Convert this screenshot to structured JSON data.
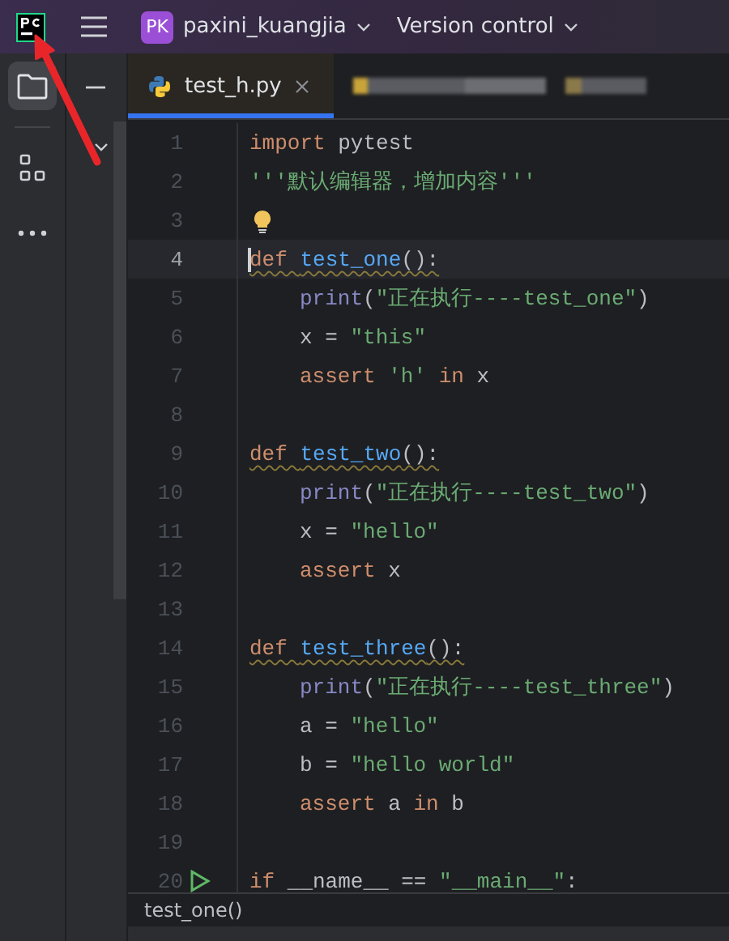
{
  "title_bar": {
    "project_initials": "PK",
    "project": "paxini_kuangjia",
    "vcs": "Version control"
  },
  "activity_bar": [
    {
      "kind": "folder",
      "selected": true
    },
    {
      "kind": "structure",
      "selected": false
    },
    {
      "kind": "more",
      "selected": false
    }
  ],
  "tabs": [
    {
      "label": "test_h.py",
      "selected": true
    }
  ],
  "lines": [
    {
      "number": "1",
      "kind": "code",
      "current": false,
      "indented": false,
      "warning": false,
      "tokens": [
        {
          "kind": "kw",
          "text": "import "
        },
        {
          "kind": "plain",
          "text": "pytest"
        }
      ]
    },
    {
      "number": "2",
      "kind": "code",
      "current": false,
      "indented": false,
      "warning": false,
      "tokens": [
        {
          "kind": "str",
          "text": "'''默认编辑器，增加内容'''"
        }
      ]
    },
    {
      "number": "3",
      "kind": "hint",
      "current": false
    },
    {
      "number": "4",
      "kind": "code",
      "current": true,
      "indented": false,
      "warning": true,
      "tokens": [
        {
          "kind": "kw",
          "text": "def "
        },
        {
          "kind": "fn",
          "text": "test_one"
        },
        {
          "kind": "plain",
          "text": "():"
        }
      ]
    },
    {
      "number": "5",
      "kind": "code",
      "current": false,
      "indented": true,
      "warning": false,
      "tokens": [
        {
          "kind": "builtin",
          "text": "print"
        },
        {
          "kind": "plain",
          "text": "("
        },
        {
          "kind": "str",
          "text": "\"正在执行----test_one\""
        },
        {
          "kind": "plain",
          "text": ")"
        }
      ]
    },
    {
      "number": "6",
      "kind": "code",
      "current": false,
      "indented": true,
      "warning": false,
      "tokens": [
        {
          "kind": "plain",
          "text": "x = "
        },
        {
          "kind": "str",
          "text": "\"this\""
        }
      ]
    },
    {
      "number": "7",
      "kind": "code",
      "current": false,
      "indented": true,
      "warning": false,
      "tokens": [
        {
          "kind": "kw",
          "text": "assert "
        },
        {
          "kind": "str",
          "text": "'h'"
        },
        {
          "kind": "kw",
          "text": " in "
        },
        {
          "kind": "plain",
          "text": "x"
        }
      ]
    },
    {
      "number": "8",
      "kind": "blank",
      "current": false
    },
    {
      "number": "9",
      "kind": "code",
      "current": false,
      "indented": false,
      "warning": true,
      "tokens": [
        {
          "kind": "kw",
          "text": "def "
        },
        {
          "kind": "fn",
          "text": "test_two"
        },
        {
          "kind": "plain",
          "text": "():"
        }
      ]
    },
    {
      "number": "10",
      "kind": "code",
      "current": false,
      "indented": true,
      "warning": false,
      "tokens": [
        {
          "kind": "builtin",
          "text": "print"
        },
        {
          "kind": "plain",
          "text": "("
        },
        {
          "kind": "str",
          "text": "\"正在执行----test_two\""
        },
        {
          "kind": "plain",
          "text": ")"
        }
      ]
    },
    {
      "number": "11",
      "kind": "code",
      "current": false,
      "indented": true,
      "warning": false,
      "tokens": [
        {
          "kind": "plain",
          "text": "x = "
        },
        {
          "kind": "str",
          "text": "\"hello\""
        }
      ]
    },
    {
      "number": "12",
      "kind": "code",
      "current": false,
      "indented": true,
      "warning": false,
      "tokens": [
        {
          "kind": "kw",
          "text": "assert "
        },
        {
          "kind": "plain",
          "text": "x"
        }
      ]
    },
    {
      "number": "13",
      "kind": "blank",
      "current": false
    },
    {
      "number": "14",
      "kind": "code",
      "current": false,
      "indented": false,
      "warning": true,
      "tokens": [
        {
          "kind": "kw",
          "text": "def "
        },
        {
          "kind": "fn",
          "text": "test_three"
        },
        {
          "kind": "plain",
          "text": "():"
        }
      ]
    },
    {
      "number": "15",
      "kind": "code",
      "current": false,
      "indented": true,
      "warning": false,
      "tokens": [
        {
          "kind": "builtin",
          "text": "print"
        },
        {
          "kind": "plain",
          "text": "("
        },
        {
          "kind": "str",
          "text": "\"正在执行----test_three\""
        },
        {
          "kind": "plain",
          "text": ")"
        }
      ]
    },
    {
      "number": "16",
      "kind": "code",
      "current": false,
      "indented": true,
      "warning": false,
      "tokens": [
        {
          "kind": "plain",
          "text": "a = "
        },
        {
          "kind": "str",
          "text": "\"hello\""
        }
      ]
    },
    {
      "number": "17",
      "kind": "code",
      "current": false,
      "indented": true,
      "warning": false,
      "tokens": [
        {
          "kind": "plain",
          "text": "b = "
        },
        {
          "kind": "str",
          "text": "\"hello world\""
        }
      ]
    },
    {
      "number": "18",
      "kind": "code",
      "current": false,
      "indented": true,
      "warning": false,
      "tokens": [
        {
          "kind": "kw",
          "text": "assert "
        },
        {
          "kind": "plain",
          "text": "a"
        },
        {
          "kind": "kw",
          "text": " in "
        },
        {
          "kind": "plain",
          "text": "b"
        }
      ]
    },
    {
      "number": "19",
      "kind": "blank",
      "current": false
    },
    {
      "number": "20",
      "kind": "run",
      "current": false,
      "indented": false,
      "tokens": [
        {
          "kind": "kw",
          "text": "if "
        },
        {
          "kind": "plain",
          "text": "__name__ == "
        },
        {
          "kind": "str",
          "text": "\"__main__\""
        },
        {
          "kind": "plain",
          "text": ":"
        }
      ]
    }
  ],
  "breadcrumb": "test_one()"
}
